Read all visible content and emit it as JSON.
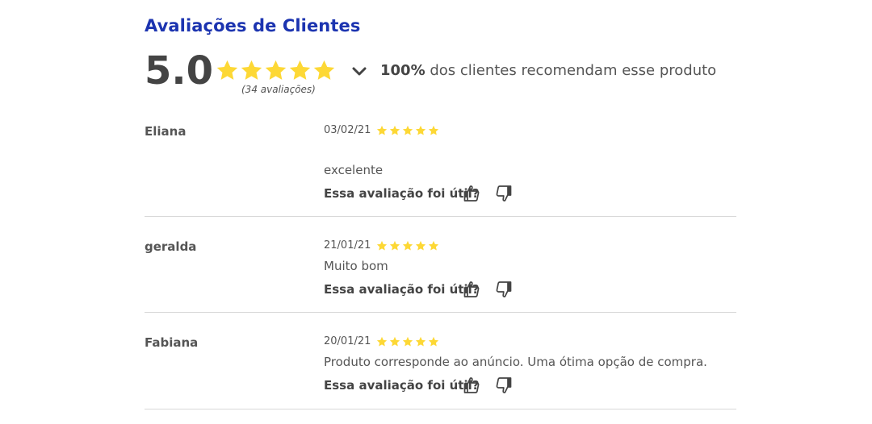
{
  "title": "Avaliações de Clientes",
  "summary": {
    "score": "5.0",
    "rating": 5,
    "count_text": "(34 avaliações)",
    "recommend_pct": "100%",
    "recommend_text": " dos clientes recomendam esse produto"
  },
  "colors": {
    "title": "#1c34b0",
    "star": "#fdd835",
    "divider": "#d8d8d8"
  },
  "reviews": [
    {
      "name": "Eliana",
      "date": "03/02/21",
      "rating": 5,
      "text": "excelente",
      "helpful_label": "Essa avaliação foi útil?"
    },
    {
      "name": "geralda",
      "date": "21/01/21",
      "rating": 5,
      "text": "Muito bom",
      "helpful_label": "Essa avaliação foi útil?"
    },
    {
      "name": "Fabiana",
      "date": "20/01/21",
      "rating": 5,
      "text": "Produto corresponde ao anúncio. Uma ótima opção de compra.",
      "helpful_label": "Essa avaliação foi útil?"
    }
  ],
  "icons": {
    "star": "star-icon",
    "chevron": "chevron-down-icon",
    "like": "thumbs-up-icon",
    "dislike": "thumbs-down-icon"
  }
}
